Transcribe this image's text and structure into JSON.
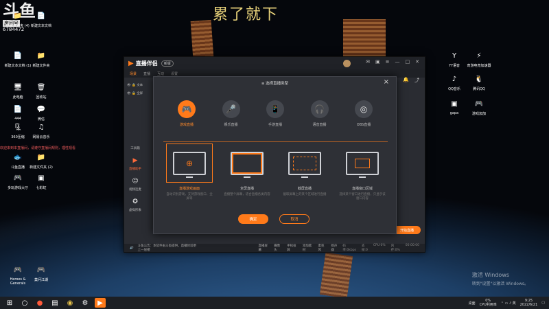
{
  "desktop": {
    "banner": "累了就下",
    "logo": {
      "big": "斗鱼",
      "small": "房间号",
      "num": "6784472"
    },
    "side_text": "欢迎来到本直播间，请遵守直播间规则，理性观看",
    "icons_left": [
      {
        "label": "新建文件夹 (4)",
        "icon": "folder-icon"
      },
      {
        "label": "新建文本文档",
        "icon": "document-icon"
      },
      {
        "label": "新建文本文档 (1)",
        "icon": "document-icon"
      },
      {
        "label": "新建文件夹",
        "icon": "folder-icon"
      },
      {
        "label": "此电脑",
        "icon": "computer-icon"
      },
      {
        "label": "回收站",
        "icon": "recycle-bin-icon"
      },
      {
        "label": "444",
        "icon": "document-icon"
      },
      {
        "label": "微信",
        "icon": "wechat-icon"
      },
      {
        "label": "360压缩",
        "icon": "archive-icon"
      },
      {
        "label": "网易云音乐",
        "icon": "music-icon"
      },
      {
        "label": "斗鱼直播",
        "icon": "douyu-icon"
      },
      {
        "label": "新建文件夹 (2)",
        "icon": "folder-icon"
      },
      {
        "label": "多玩游戏大厅",
        "icon": "game-icon"
      },
      {
        "label": "七彩虹",
        "icon": "app-icon"
      },
      {
        "label": "Heroes & Generals",
        "icon": "game-icon"
      },
      {
        "label": "莫问江湖",
        "icon": "game-icon"
      }
    ],
    "icons_right": [
      {
        "label": "YY语音",
        "icon": "yy-icon"
      },
      {
        "label": "奇游电竞加速器",
        "icon": "speed-icon"
      },
      {
        "label": "QQ音乐",
        "icon": "qq-music-icon"
      },
      {
        "label": "腾讯QQ",
        "icon": "qq-icon"
      },
      {
        "label": "gapa",
        "icon": "app-icon"
      },
      {
        "label": "游戏加加",
        "icon": "game-icon"
      }
    ],
    "watermark": {
      "line1": "激活 Windows",
      "line2": "转到\"设置\"以激活 Windows。"
    }
  },
  "taskbar": {
    "search_icon": "search-icon",
    "tray_text": "桌面",
    "cpu_label": "CPU利用率",
    "cpu_value": "0%",
    "time": "9:25",
    "date": "2022/6/21"
  },
  "app": {
    "title": "直播伴侣",
    "version": "新版",
    "tabs": [
      "场景",
      "直播",
      "互动",
      "设置"
    ],
    "scene_items": [
      "文本",
      "全屏"
    ],
    "rail": [
      {
        "label": "工具箱",
        "icon": "toolbox-icon"
      },
      {
        "label": "直播助手",
        "icon": "live-helper-icon"
      },
      {
        "label": "视频连麦",
        "icon": "video-call-icon"
      },
      {
        "label": "虚拟形象",
        "icon": "avatar-icon"
      }
    ],
    "bottom_left": "斗鱼公告：本软件由斗鱼提供，直播体验更上一层楼",
    "bottom_mid": [
      "直播屏幕",
      "摄像头",
      "手机投屏",
      "添加素材",
      "麦克风",
      "扬声器"
    ],
    "bottom_stats": [
      "码率:0kbps",
      "丢帧:0",
      "CPU:0%",
      "内存:0%",
      "00:00:00"
    ],
    "start_live": "开始直播"
  },
  "modal": {
    "title": "选择直播类型",
    "types": [
      {
        "label": "游戏直播",
        "icon": "gamepad-icon",
        "active": true
      },
      {
        "label": "娱乐直播",
        "icon": "microphone-icon",
        "active": false
      },
      {
        "label": "手游直播",
        "icon": "phone-icon",
        "active": false
      },
      {
        "label": "语音直播",
        "icon": "headphone-icon",
        "active": false
      },
      {
        "label": "OBS直播",
        "icon": "obs-icon",
        "active": false
      }
    ],
    "modes": [
      {
        "label": "直播游戏画面",
        "desc": "自动识别游戏，支持游戏窗口、全屏等",
        "active": true
      },
      {
        "label": "全屏直播",
        "desc": "直播整个屏幕，适合直播各类内容",
        "active": false
      },
      {
        "label": "截屏直播",
        "desc": "截取屏幕上的某个区域进行直播",
        "active": false
      },
      {
        "label": "直播窗口区域",
        "desc": "选择某个窗口进行直播，只显示该窗口内容",
        "active": false
      }
    ],
    "ok": "确定",
    "cancel": "取消"
  }
}
